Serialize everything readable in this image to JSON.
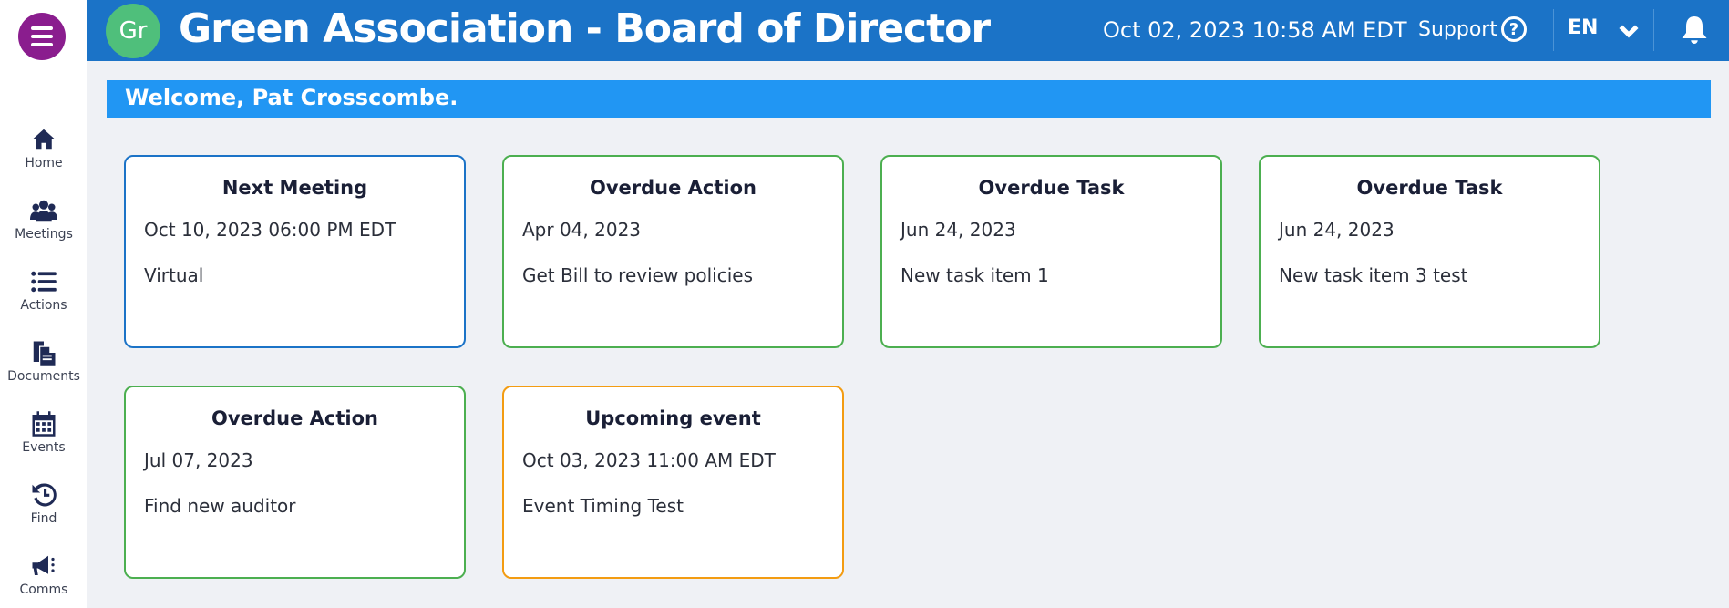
{
  "sidebar": {
    "menu_icon": "hamburger-icon",
    "items": [
      {
        "label": "Home",
        "icon": "home-icon"
      },
      {
        "label": "Meetings",
        "icon": "users-icon"
      },
      {
        "label": "Actions",
        "icon": "list-icon"
      },
      {
        "label": "Documents",
        "icon": "documents-icon"
      },
      {
        "label": "Events",
        "icon": "calendar-icon"
      },
      {
        "label": "Find",
        "icon": "history-icon"
      },
      {
        "label": "Comms",
        "icon": "megaphone-icon"
      }
    ]
  },
  "header": {
    "avatar_initials": "Gr",
    "title": "Green Association - Board of Director",
    "datetime": "Oct 02, 2023 10:58 AM  EDT",
    "support_label": "Support",
    "support_icon_glyph": "?",
    "language": "EN",
    "colors": {
      "bar": "#1b73c7",
      "avatar": "#4fbf7b",
      "menu": "#8a1d8e"
    }
  },
  "welcome": {
    "text": "Welcome, Pat Crosscombe."
  },
  "cards": [
    {
      "title": "Next Meeting",
      "date": "Oct 10, 2023 06:00 PM EDT",
      "description": "Virtual",
      "border_color": "#1b73c7"
    },
    {
      "title": "Overdue Action",
      "date": "Apr 04, 2023",
      "description": "Get Bill to review policies",
      "border_color": "#4caf50"
    },
    {
      "title": "Overdue Task",
      "date": "Jun 24, 2023",
      "description": "New task item 1",
      "border_color": "#4caf50"
    },
    {
      "title": "Overdue Task",
      "date": "Jun 24, 2023",
      "description": "New task item 3 test",
      "border_color": "#4caf50"
    },
    {
      "title": "Overdue Action",
      "date": "Jul 07, 2023",
      "description": "Find new auditor",
      "border_color": "#4caf50"
    },
    {
      "title": "Upcoming event",
      "date": "Oct 03, 2023 11:00 AM EDT",
      "description": "Event Timing Test",
      "border_color": "#f39c12"
    }
  ]
}
